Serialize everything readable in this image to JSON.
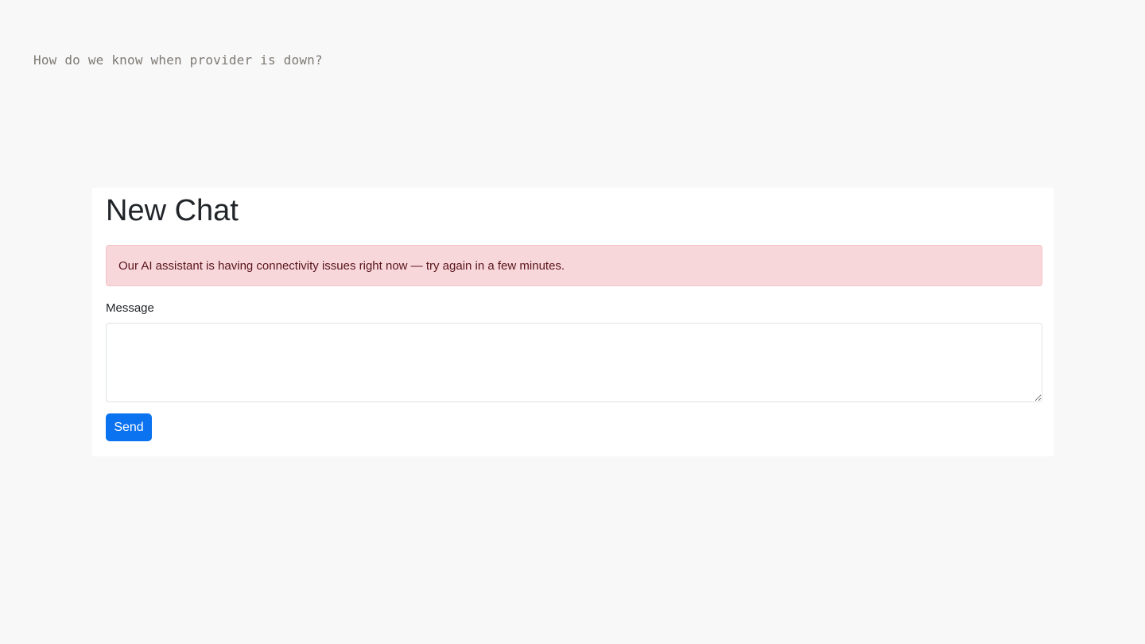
{
  "question": {
    "text": "How do we know when provider is down?"
  },
  "chat_panel": {
    "title": "New Chat",
    "alert_text": "Our AI assistant is having connectivity issues right now — try again in a few minutes.",
    "message_label": "Message",
    "message_value": "",
    "send_label": "Send"
  },
  "colors": {
    "page_background": "#f8f8f8",
    "alert_background": "#f8d7da",
    "alert_text": "#58151c",
    "button_primary": "#0b72f0"
  }
}
